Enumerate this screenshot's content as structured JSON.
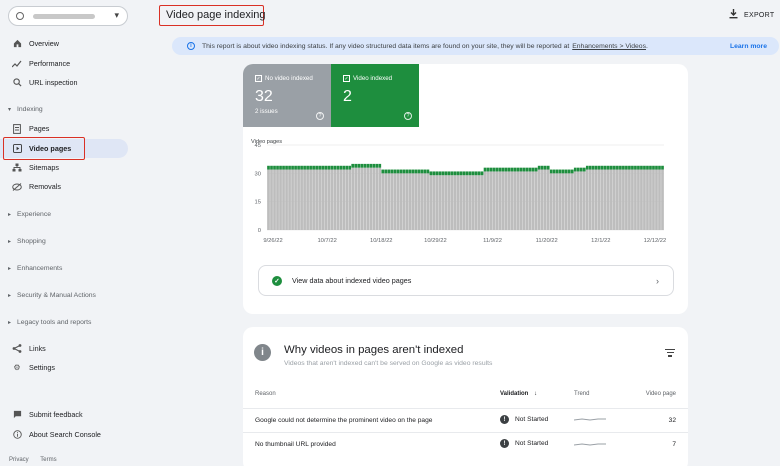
{
  "sidebar": {
    "property_caret": "▾",
    "top_items": [
      {
        "label": "Overview",
        "icon": "home-icon"
      },
      {
        "label": "Performance",
        "icon": "trend-icon"
      },
      {
        "label": "URL inspection",
        "icon": "search-icon"
      }
    ],
    "indexing_section": "Indexing",
    "indexing_items": [
      {
        "label": "Pages",
        "icon": "page-icon"
      },
      {
        "label": "Video pages",
        "icon": "video-page-icon"
      },
      {
        "label": "Sitemaps",
        "icon": "sitemap-icon"
      },
      {
        "label": "Removals",
        "icon": "removals-icon"
      }
    ],
    "sections": [
      "Experience",
      "Shopping",
      "Enhancements",
      "Security & Manual Actions",
      "Legacy tools and reports"
    ],
    "bottom_items": [
      {
        "label": "Links",
        "icon": "links-icon"
      },
      {
        "label": "Settings",
        "icon": "gear-icon"
      }
    ],
    "footer_items": [
      {
        "label": "Submit feedback",
        "icon": "feedback-icon"
      },
      {
        "label": "About Search Console",
        "icon": "info-icon"
      }
    ],
    "footer_links": [
      "Privacy",
      "Terms"
    ]
  },
  "header": {
    "title": "Video page indexing",
    "export_label": "EXPORT"
  },
  "banner": {
    "text": "This report is about video indexing status. If any video structured data items are found on your site, they will be reported at",
    "link": "Enhancements > Videos",
    "suffix": ".",
    "learn_more": "Learn more"
  },
  "summary": {
    "not_indexed": {
      "label": "No video indexed",
      "count": "32",
      "sub": "2 issues",
      "color": "#9aa0a6"
    },
    "indexed": {
      "label": "Video indexed",
      "count": "2",
      "color": "#1e8e3e"
    }
  },
  "chart_data": {
    "type": "bar",
    "ylabel": "Video pages",
    "ylim": [
      0,
      45
    ],
    "yticks": [
      "45",
      "30",
      "15",
      "0"
    ],
    "xticks": [
      "9/26/22",
      "10/7/22",
      "10/18/22",
      "10/29/22",
      "11/9/22",
      "11/20/22",
      "12/1/22",
      "12/12/22"
    ],
    "series": [
      {
        "values": [
          32,
          32,
          32,
          32,
          32,
          32,
          32,
          32,
          32,
          32,
          32,
          32,
          32,
          32,
          32,
          32,
          32,
          32,
          32,
          32,
          32,
          32,
          32,
          32,
          32,
          32,
          32,
          32,
          33,
          33,
          33,
          33,
          33,
          33,
          33,
          33,
          33,
          33,
          30,
          30,
          30,
          30,
          30,
          30,
          30,
          30,
          30,
          30,
          30,
          30,
          30,
          30,
          30,
          30,
          29,
          29,
          29,
          29,
          29,
          29,
          29,
          29,
          29,
          29,
          29,
          29,
          29,
          29,
          29,
          29,
          29,
          29,
          31,
          31,
          31,
          31,
          31,
          31,
          31,
          31,
          31,
          31,
          31,
          31,
          31,
          31,
          31,
          31,
          31,
          31,
          32,
          32,
          32,
          32,
          30,
          30,
          30,
          30,
          30,
          30,
          30,
          30,
          31,
          31,
          31,
          31,
          32,
          32,
          32,
          32,
          32,
          32,
          32,
          32,
          32,
          32,
          32,
          32,
          32,
          32,
          32,
          32,
          32,
          32,
          32,
          32,
          32,
          32,
          32,
          32,
          32,
          32
        ]
      },
      {
        "values": [
          2,
          2,
          2,
          2,
          2,
          2,
          2,
          2,
          2,
          2,
          2,
          2,
          2,
          2,
          2,
          2,
          2,
          2,
          2,
          2,
          2,
          2,
          2,
          2,
          2,
          2,
          2,
          2,
          2,
          2,
          2,
          2,
          2,
          2,
          2,
          2,
          2,
          2,
          2,
          2,
          2,
          2,
          2,
          2,
          2,
          2,
          2,
          2,
          2,
          2,
          2,
          2,
          2,
          2,
          2,
          2,
          2,
          2,
          2,
          2,
          2,
          2,
          2,
          2,
          2,
          2,
          2,
          2,
          2,
          2,
          2,
          2,
          2,
          2,
          2,
          2,
          2,
          2,
          2,
          2,
          2,
          2,
          2,
          2,
          2,
          2,
          2,
          2,
          2,
          2,
          2,
          2,
          2,
          2,
          2,
          2,
          2,
          2,
          2,
          2,
          2,
          2,
          2,
          2,
          2,
          2,
          2,
          2,
          2,
          2,
          2,
          2,
          2,
          2,
          2,
          2,
          2,
          2,
          2,
          2,
          2,
          2,
          2,
          2,
          2,
          2,
          2,
          2,
          2,
          2,
          2,
          2
        ]
      }
    ],
    "colors": [
      "#bdbdbd",
      "#1e8e3e"
    ]
  },
  "view_indexed": {
    "label": "View data about indexed video pages",
    "chevron": "›"
  },
  "why": {
    "title": "Why videos in pages aren't indexed",
    "subtitle": "Videos that aren't indexed can't be served on Google as video results",
    "columns": {
      "reason": "Reason",
      "validation": "Validation",
      "trend": "Trend",
      "count": "Video page"
    },
    "sort_arrow": "↓",
    "rows": [
      {
        "reason": "Google could not determine the prominent video on the page",
        "validation": "Not Started",
        "count": "32"
      },
      {
        "reason": "No thumbnail URL provided",
        "validation": "Not Started",
        "count": "7"
      }
    ]
  }
}
